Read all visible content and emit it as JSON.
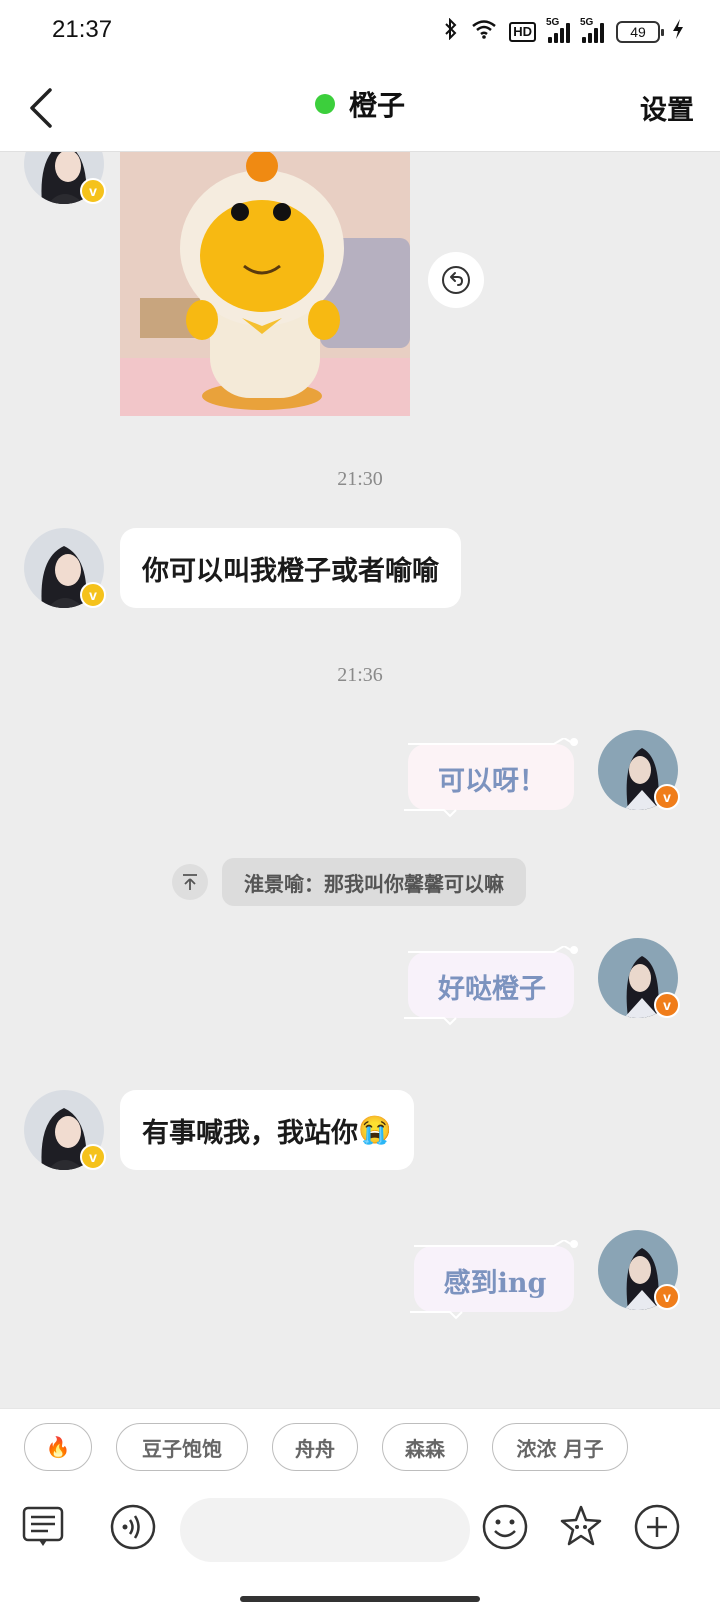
{
  "status_bar": {
    "time": "21:37",
    "hd_label": "HD",
    "signal_label_1": "5G",
    "signal_label_2": "5G",
    "battery": "49",
    "icons": [
      "bluetooth-icon",
      "wifi-icon",
      "hd-icon",
      "signal-icon",
      "signal-icon",
      "battery-icon",
      "charging-icon"
    ]
  },
  "header": {
    "title": "橙子",
    "settings_label": "设置",
    "online_color": "#3ccf3c"
  },
  "messages": {
    "time_1": "21:30",
    "msg_1": "你可以叫我橙子或者喻喻",
    "time_2": "21:36",
    "msg_2": "可以呀！",
    "quote": "淮景喻：那我叫你馨馨可以嘛",
    "msg_3": "好哒橙子",
    "msg_4": "有事喊我，我站你",
    "msg_4_emoji": "😭",
    "msg_5": "感到ing"
  },
  "quick_replies": [
    "🔥",
    "豆子饱饱",
    "舟舟",
    "森森",
    "浓浓 月子"
  ],
  "input": {
    "placeholder": ""
  },
  "colors": {
    "accent_blue_text": "#7c93bf",
    "badge_yellow": "#f5c21b",
    "badge_orange": "#f07d1a"
  }
}
